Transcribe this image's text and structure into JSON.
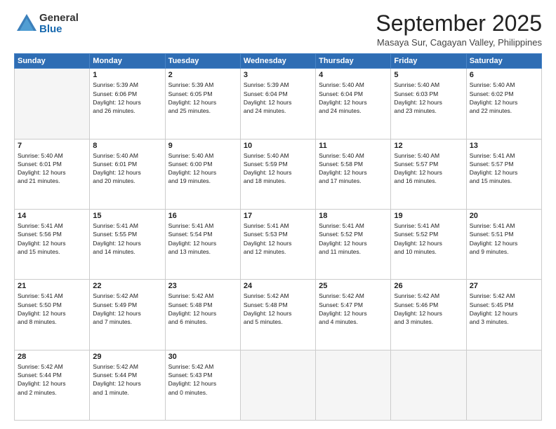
{
  "logo": {
    "general": "General",
    "blue": "Blue"
  },
  "title": "September 2025",
  "location": "Masaya Sur, Cagayan Valley, Philippines",
  "days_of_week": [
    "Sunday",
    "Monday",
    "Tuesday",
    "Wednesday",
    "Thursday",
    "Friday",
    "Saturday"
  ],
  "weeks": [
    [
      {
        "day": "",
        "info": ""
      },
      {
        "day": "1",
        "info": "Sunrise: 5:39 AM\nSunset: 6:06 PM\nDaylight: 12 hours\nand 26 minutes."
      },
      {
        "day": "2",
        "info": "Sunrise: 5:39 AM\nSunset: 6:05 PM\nDaylight: 12 hours\nand 25 minutes."
      },
      {
        "day": "3",
        "info": "Sunrise: 5:39 AM\nSunset: 6:04 PM\nDaylight: 12 hours\nand 24 minutes."
      },
      {
        "day": "4",
        "info": "Sunrise: 5:40 AM\nSunset: 6:04 PM\nDaylight: 12 hours\nand 24 minutes."
      },
      {
        "day": "5",
        "info": "Sunrise: 5:40 AM\nSunset: 6:03 PM\nDaylight: 12 hours\nand 23 minutes."
      },
      {
        "day": "6",
        "info": "Sunrise: 5:40 AM\nSunset: 6:02 PM\nDaylight: 12 hours\nand 22 minutes."
      }
    ],
    [
      {
        "day": "7",
        "info": "Sunrise: 5:40 AM\nSunset: 6:01 PM\nDaylight: 12 hours\nand 21 minutes."
      },
      {
        "day": "8",
        "info": "Sunrise: 5:40 AM\nSunset: 6:01 PM\nDaylight: 12 hours\nand 20 minutes."
      },
      {
        "day": "9",
        "info": "Sunrise: 5:40 AM\nSunset: 6:00 PM\nDaylight: 12 hours\nand 19 minutes."
      },
      {
        "day": "10",
        "info": "Sunrise: 5:40 AM\nSunset: 5:59 PM\nDaylight: 12 hours\nand 18 minutes."
      },
      {
        "day": "11",
        "info": "Sunrise: 5:40 AM\nSunset: 5:58 PM\nDaylight: 12 hours\nand 17 minutes."
      },
      {
        "day": "12",
        "info": "Sunrise: 5:40 AM\nSunset: 5:57 PM\nDaylight: 12 hours\nand 16 minutes."
      },
      {
        "day": "13",
        "info": "Sunrise: 5:41 AM\nSunset: 5:57 PM\nDaylight: 12 hours\nand 15 minutes."
      }
    ],
    [
      {
        "day": "14",
        "info": "Sunrise: 5:41 AM\nSunset: 5:56 PM\nDaylight: 12 hours\nand 15 minutes."
      },
      {
        "day": "15",
        "info": "Sunrise: 5:41 AM\nSunset: 5:55 PM\nDaylight: 12 hours\nand 14 minutes."
      },
      {
        "day": "16",
        "info": "Sunrise: 5:41 AM\nSunset: 5:54 PM\nDaylight: 12 hours\nand 13 minutes."
      },
      {
        "day": "17",
        "info": "Sunrise: 5:41 AM\nSunset: 5:53 PM\nDaylight: 12 hours\nand 12 minutes."
      },
      {
        "day": "18",
        "info": "Sunrise: 5:41 AM\nSunset: 5:52 PM\nDaylight: 12 hours\nand 11 minutes."
      },
      {
        "day": "19",
        "info": "Sunrise: 5:41 AM\nSunset: 5:52 PM\nDaylight: 12 hours\nand 10 minutes."
      },
      {
        "day": "20",
        "info": "Sunrise: 5:41 AM\nSunset: 5:51 PM\nDaylight: 12 hours\nand 9 minutes."
      }
    ],
    [
      {
        "day": "21",
        "info": "Sunrise: 5:41 AM\nSunset: 5:50 PM\nDaylight: 12 hours\nand 8 minutes."
      },
      {
        "day": "22",
        "info": "Sunrise: 5:42 AM\nSunset: 5:49 PM\nDaylight: 12 hours\nand 7 minutes."
      },
      {
        "day": "23",
        "info": "Sunrise: 5:42 AM\nSunset: 5:48 PM\nDaylight: 12 hours\nand 6 minutes."
      },
      {
        "day": "24",
        "info": "Sunrise: 5:42 AM\nSunset: 5:48 PM\nDaylight: 12 hours\nand 5 minutes."
      },
      {
        "day": "25",
        "info": "Sunrise: 5:42 AM\nSunset: 5:47 PM\nDaylight: 12 hours\nand 4 minutes."
      },
      {
        "day": "26",
        "info": "Sunrise: 5:42 AM\nSunset: 5:46 PM\nDaylight: 12 hours\nand 3 minutes."
      },
      {
        "day": "27",
        "info": "Sunrise: 5:42 AM\nSunset: 5:45 PM\nDaylight: 12 hours\nand 3 minutes."
      }
    ],
    [
      {
        "day": "28",
        "info": "Sunrise: 5:42 AM\nSunset: 5:44 PM\nDaylight: 12 hours\nand 2 minutes."
      },
      {
        "day": "29",
        "info": "Sunrise: 5:42 AM\nSunset: 5:44 PM\nDaylight: 12 hours\nand 1 minute."
      },
      {
        "day": "30",
        "info": "Sunrise: 5:42 AM\nSunset: 5:43 PM\nDaylight: 12 hours\nand 0 minutes."
      },
      {
        "day": "",
        "info": ""
      },
      {
        "day": "",
        "info": ""
      },
      {
        "day": "",
        "info": ""
      },
      {
        "day": "",
        "info": ""
      }
    ]
  ]
}
